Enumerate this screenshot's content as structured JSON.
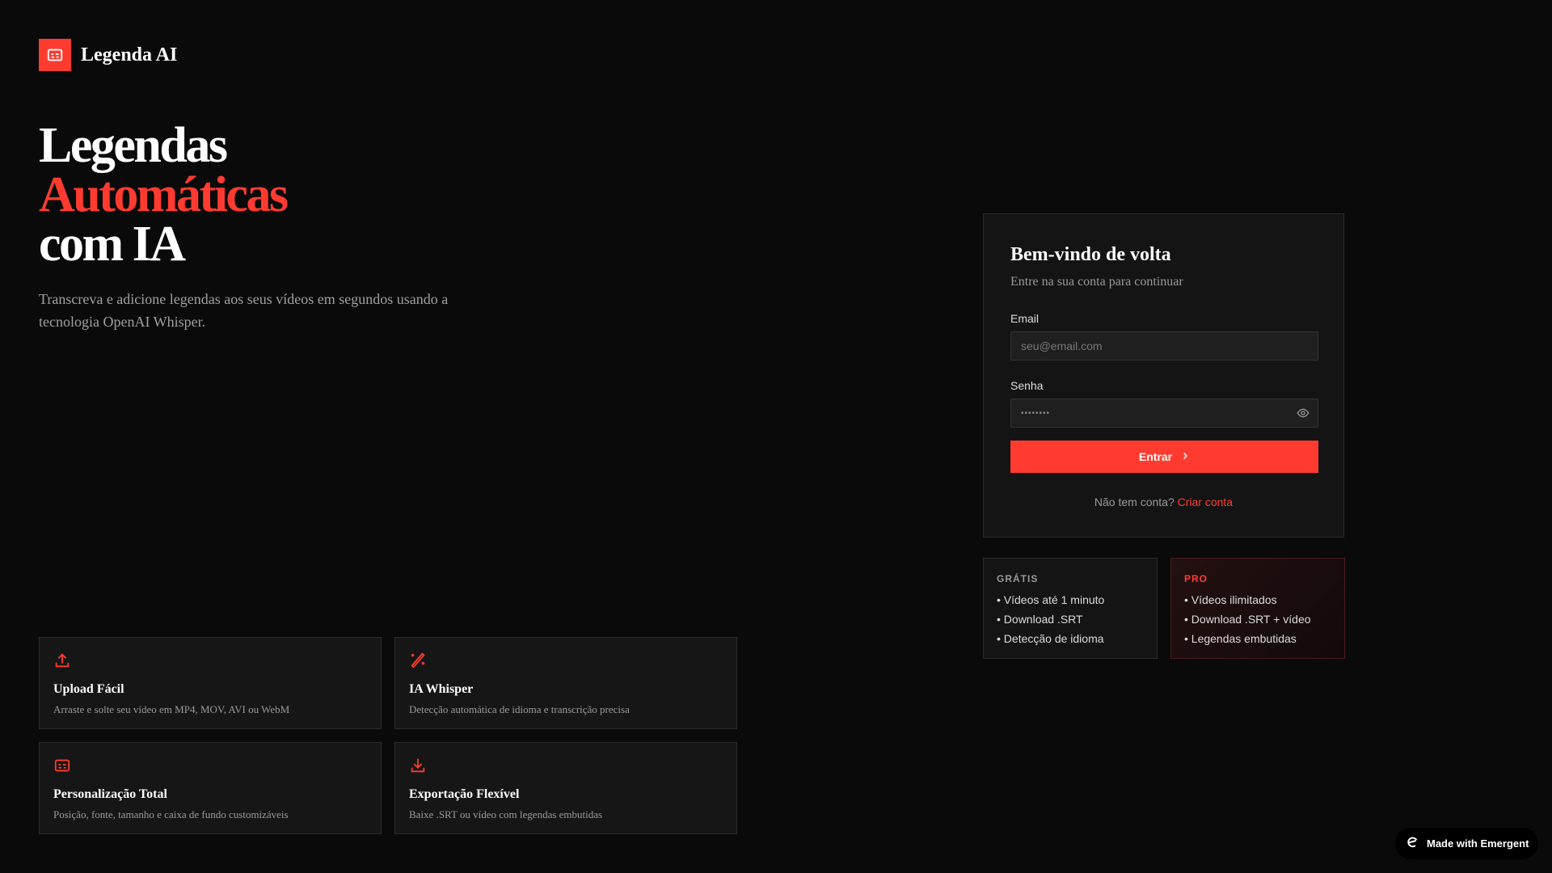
{
  "brand": {
    "name": "Legenda AI"
  },
  "hero": {
    "line1": "Legendas",
    "line2": "Automáticas",
    "line3": "com IA",
    "lead": "Transcreva e adicione legendas aos seus vídeos em segundos usando a tecnologia OpenAI Whisper."
  },
  "login": {
    "title": "Bem-vindo de volta",
    "subtitle": "Entre na sua conta para continuar",
    "email_label": "Email",
    "email_placeholder": "seu@email.com",
    "password_label": "Senha",
    "password_value": "••••••••",
    "submit": "Entrar",
    "no_account": "Não tem conta?",
    "create": "Criar conta"
  },
  "plans": [
    {
      "name": "GRÁTIS",
      "items": [
        "• Vídeos até 1 minuto",
        "• Download .SRT",
        "• Detecção de idioma"
      ]
    },
    {
      "name": "PRO",
      "items": [
        "• Vídeos ilimitados",
        "• Download .SRT + vídeo",
        "• Legendas embutidas"
      ]
    }
  ],
  "features": [
    {
      "icon": "upload-icon",
      "title": "Upload Fácil",
      "desc": "Arraste e solte seu vídeo em MP4, MOV, AVI ou WebM"
    },
    {
      "icon": "magic-wand-icon",
      "title": "IA Whisper",
      "desc": "Detecção automática de idioma e transcrição precisa"
    },
    {
      "icon": "subtitles-icon",
      "title": "Personalização Total",
      "desc": "Posição, fonte, tamanho e caixa de fundo customizáveis"
    },
    {
      "icon": "download-icon",
      "title": "Exportação Flexível",
      "desc": "Baixe .SRT ou vídeo com legendas embutidas"
    }
  ],
  "badge": {
    "label": "Made with Emergent"
  },
  "colors": {
    "accent": "#ff3b30",
    "bg": "#0a0a0a"
  }
}
